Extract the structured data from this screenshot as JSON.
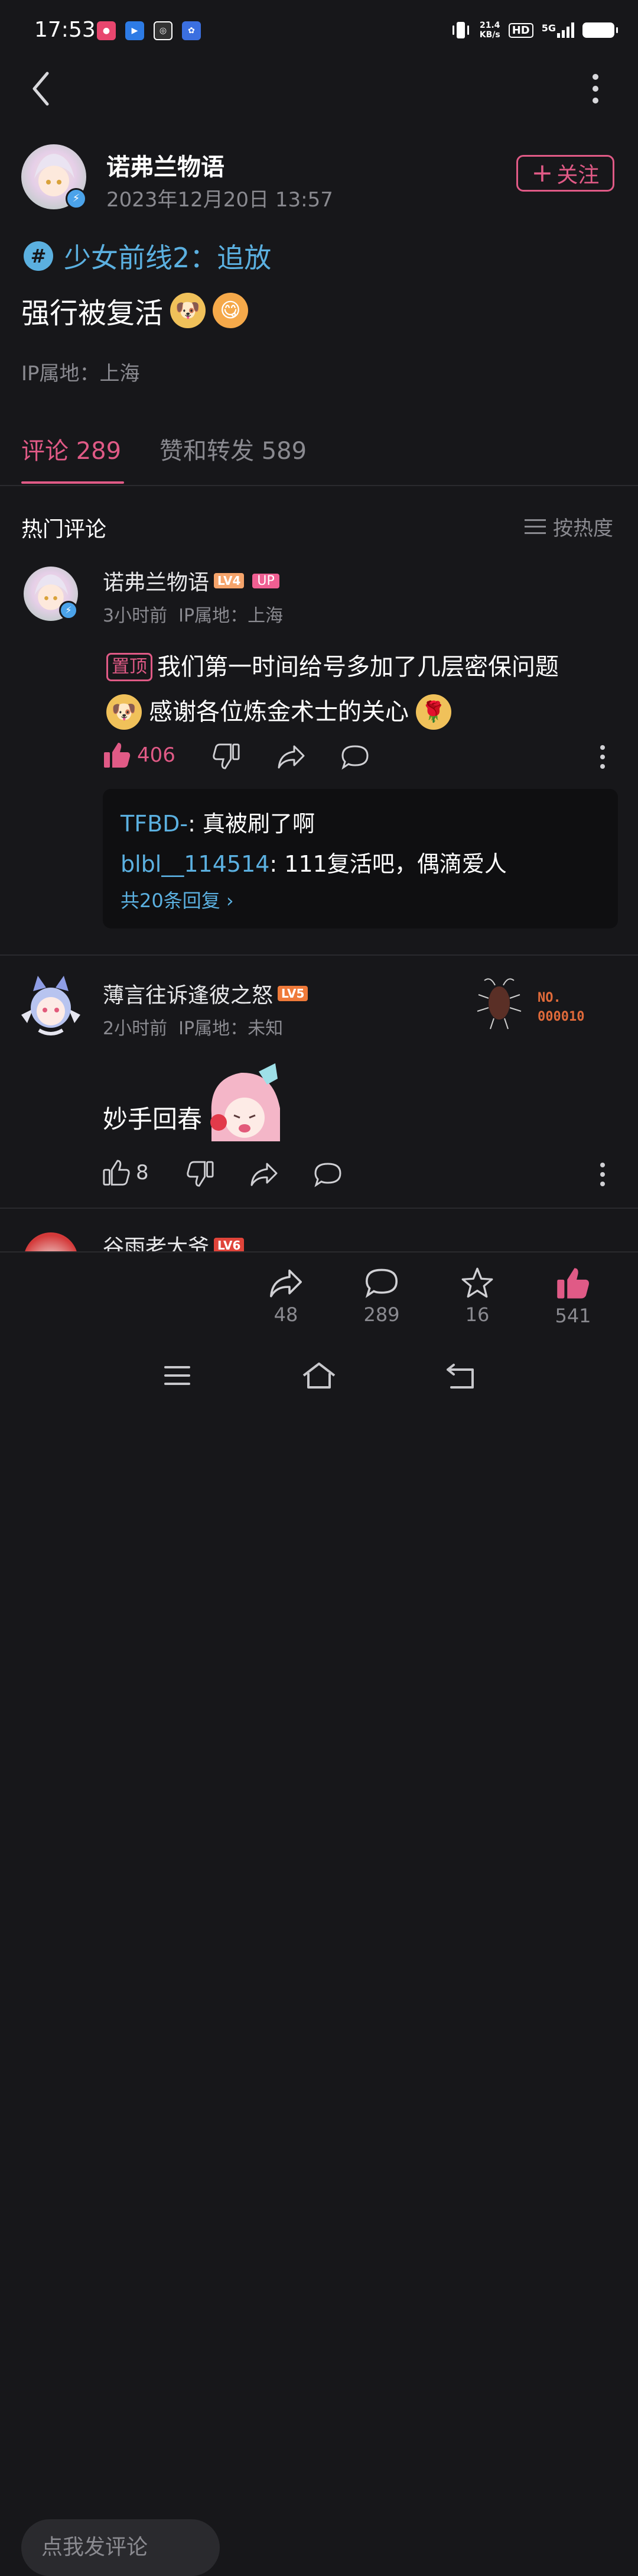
{
  "status_bar": {
    "time": "17:53",
    "net_speed_value": "21.4",
    "net_speed_unit": "KB/s",
    "hd": "HD",
    "network": "5G"
  },
  "post": {
    "author": "诺弗兰物语",
    "datetime": "2023年12月20日 13:57",
    "follow_label": "关注",
    "topic": "少女前线2：追放",
    "text": "强行被复活",
    "ip_location": "IP属地：上海"
  },
  "tabs": [
    {
      "label": "评论 289",
      "active": true
    },
    {
      "label": "赞和转发 589",
      "active": false
    }
  ],
  "comments_header": {
    "title": "热门评论",
    "sort_label": "按热度"
  },
  "comments": [
    {
      "username": "诺弗兰物语",
      "level": "LV4",
      "up_badge": "UP",
      "meta": "3小时前  IP属地：上海",
      "pinned_tag": "置顶",
      "text_line1": "我们第一时间给号多加了几层密保问题",
      "text_line2": "感谢各位炼金术士的关心",
      "likes": "406",
      "replies": [
        {
          "user": "TFBD-",
          "text": ": 真被刷了啊"
        },
        {
          "user": "blbl__114514",
          "text": ": 111复活吧，偶滴爱人"
        }
      ],
      "more_replies": "共20条回复 ›"
    },
    {
      "username": "薄言往诉逢彼之怒",
      "level": "LV5",
      "meta": "2小时前  IP属地：未知",
      "badge_no": "NO.",
      "badge_num": "000010",
      "text": "妙手回春",
      "likes": "8"
    },
    {
      "username": "谷雨老大爷",
      "level": "LV6"
    }
  ],
  "bottom_bar": {
    "input_placeholder": "点我发评论",
    "share_count": "48",
    "comment_count": "289",
    "favorite_count": "16",
    "like_count": "541"
  },
  "colors": {
    "accent_pink": "#e05a86",
    "topic_blue": "#5bb0e0",
    "background": "#17171a"
  }
}
